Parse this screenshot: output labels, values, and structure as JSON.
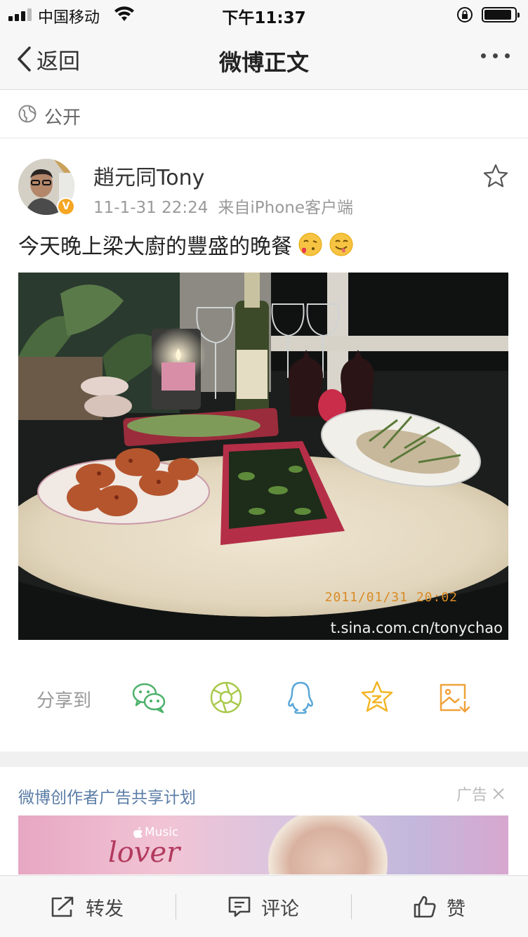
{
  "status_bar": {
    "carrier": "中国移动",
    "time": "下午11:37"
  },
  "nav": {
    "back_label": "返回",
    "title": "微博正文"
  },
  "visibility": {
    "label": "公开"
  },
  "post": {
    "author": "趙元同Tony",
    "timestamp": "11-1-31 22:24",
    "source": "来自iPhone客户端",
    "text": "今天晚上梁大廚的豐盛的晚餐",
    "photo_timestamp": "2011/01/31 20:02",
    "photo_watermark": "t.sina.com.cn/tonychao"
  },
  "share": {
    "label": "分享到",
    "targets": [
      "wechat-icon",
      "moments-icon",
      "qq-icon",
      "qzone-icon",
      "save-image-icon"
    ]
  },
  "ad": {
    "title": "微博创作者广告共享计划",
    "tag": "广告",
    "banner_brand": "Music",
    "banner_script": "lover"
  },
  "toolbar": {
    "repost": "转发",
    "comment": "评论",
    "like": "赞"
  },
  "colors": {
    "link_blue": "#5a7ca6",
    "verified_orange": "#f5a623",
    "wechat_green": "#4cb16a",
    "moments_green": "#a8c94a",
    "qq_blue": "#5aa7d8",
    "qzone_yellow": "#f3b524",
    "save_orange": "#f0a23a"
  }
}
